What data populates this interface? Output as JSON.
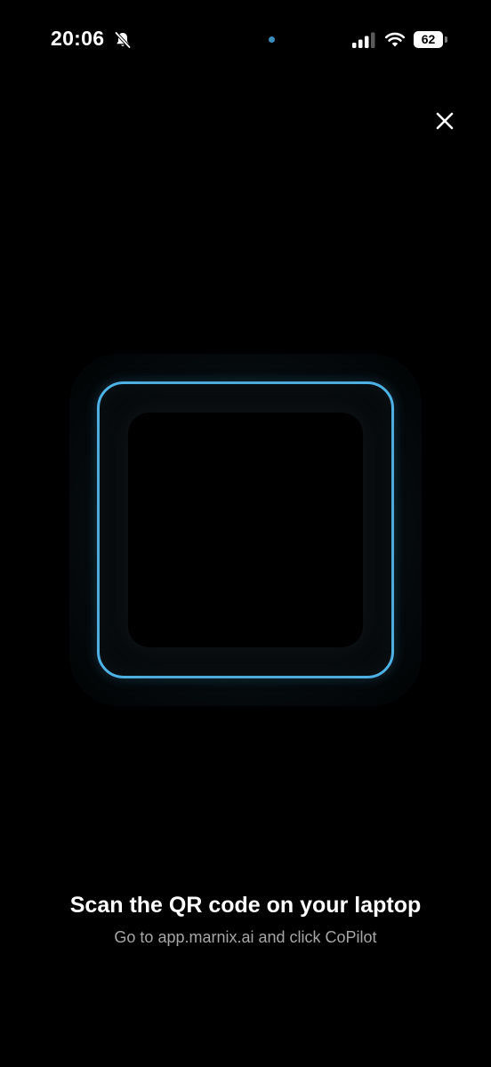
{
  "status_bar": {
    "time": "20:06",
    "battery_level": "62",
    "icons": [
      "bell-slash-icon",
      "privacy-dot",
      "cellular-signal-icon",
      "wifi-icon",
      "battery-icon"
    ],
    "privacy_dot_color": "#3a8fbf"
  },
  "toolbar": {
    "close_icon": "close-icon"
  },
  "scanner": {
    "frame_color": "#4fb3e6"
  },
  "instructions": {
    "title": "Scan the QR code on your laptop",
    "subtitle": "Go to app.marnix.ai and click CoPilot"
  }
}
